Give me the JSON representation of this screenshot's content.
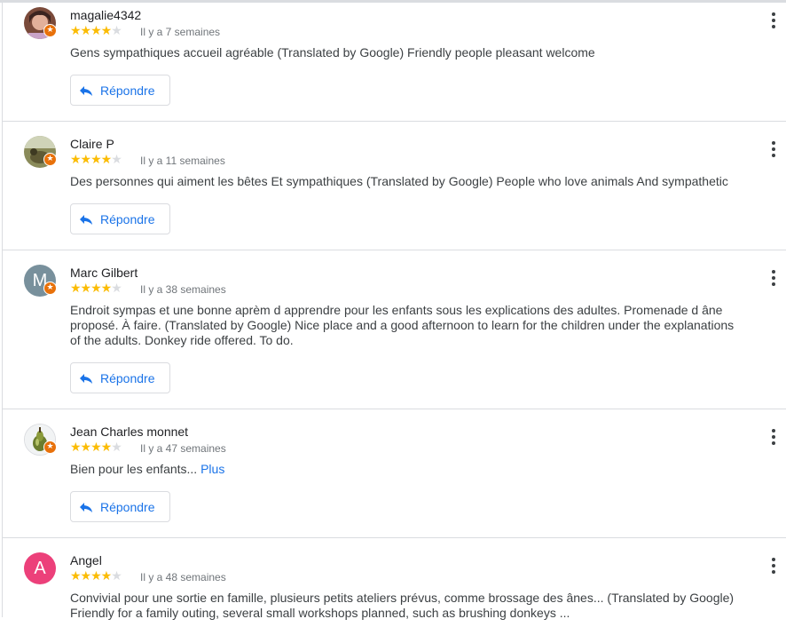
{
  "reply_label": "Répondre",
  "more_label": "Plus",
  "colors": {
    "star": "#fbbc04",
    "accent": "#1a73e8",
    "badge": "#e8710a"
  },
  "reviews": [
    {
      "author": "magalie4342",
      "rating": 4,
      "time": "Il y a 7 semaines",
      "text": "Gens sympathiques accueil agréable (Translated by Google) Friendly people pleasant welcome"
    },
    {
      "author": "Claire P",
      "rating": 4,
      "time": "Il y a 11 semaines",
      "text": "Des personnes qui aiment les bêtes Et sympathiques (Translated by Google) People who love animals And sympathetic"
    },
    {
      "author": "Marc Gilbert",
      "rating": 4,
      "time": "Il y a 38 semaines",
      "avatar_letter": "M",
      "text": "Endroit sympas et une bonne aprèm d apprendre pour les enfants sous les explications des adultes. Promenade d âne proposé. À faire. (Translated by Google) Nice place and a good afternoon to learn for the children under the explanations of the adults. Donkey ride offered. To do."
    },
    {
      "author": "Jean Charles monnet",
      "rating": 4,
      "time": "Il y a 47 semaines",
      "text": "Bien pour les enfants..."
    },
    {
      "author": "Angel",
      "rating": 4,
      "time": "Il y a 48 semaines",
      "avatar_letter": "A",
      "text": "Convivial pour une sortie en famille, plusieurs petits ateliers prévus, comme brossage des ânes... (Translated by Google) Friendly for a family outing, several small workshops planned, such as brushing donkeys ..."
    }
  ]
}
